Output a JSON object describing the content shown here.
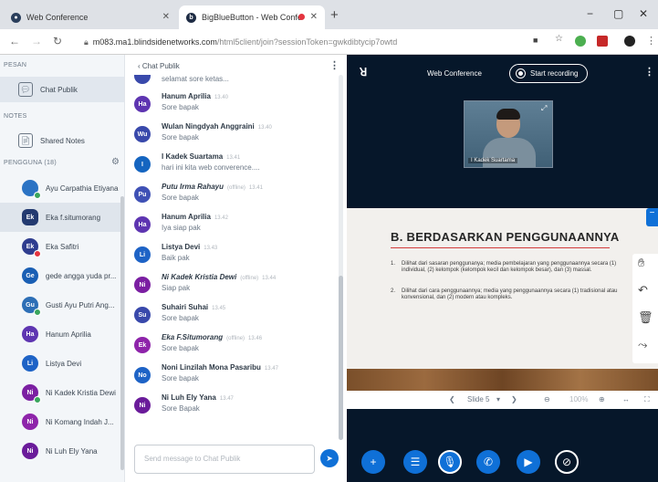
{
  "browser": {
    "tabs": [
      {
        "label": "Web Conference",
        "favicon_color": "#2a3e5c"
      },
      {
        "label": "BigBlueButton - Web Confe",
        "favicon_color": "#1e2c44",
        "recording_dot_color": "#e4343f"
      }
    ],
    "new_tab_icon": "+",
    "win_minimize": "−",
    "win_maximize": "▢",
    "win_close": "✕",
    "url_host": "m083.ma1.blindsidenetworks.com",
    "url_path": "/html5client/join?sessionToken=gwkdibtycip7owtd"
  },
  "sidebar": {
    "messages_header": "PESAN",
    "chat_label": "Chat Publik",
    "notes_header": "NOTES",
    "notes_label": "Shared Notes",
    "users_header": "PENGGUNA (18)",
    "users": [
      {
        "initials": "",
        "name": "Ayu Carpathia Etiyana",
        "color": "#2b73c4",
        "round": true,
        "status_color": "#3aa55d",
        "selected": false
      },
      {
        "initials": "Ek",
        "name": "Eka f.situmorang",
        "color": "#233a70",
        "round": false,
        "status_color": "",
        "selected": true
      },
      {
        "initials": "Ek",
        "name": "Eka Safitri",
        "color": "#2f3d8f",
        "round": true,
        "status_color": "#e4343f",
        "selected": false
      },
      {
        "initials": "Ge",
        "name": "gede angga yuda pr...",
        "color": "#1a5fb4",
        "round": true,
        "status_color": "",
        "selected": false
      },
      {
        "initials": "Gu",
        "name": "Gusti Ayu Putri Ang...",
        "color": "#2d6fb6",
        "round": true,
        "status_color": "#3aa55d",
        "selected": false
      },
      {
        "initials": "Ha",
        "name": "Hanum Aprilia",
        "color": "#5e35b1",
        "round": true,
        "status_color": "",
        "selected": false
      },
      {
        "initials": "Li",
        "name": "Listya Devi",
        "color": "#1e63c6",
        "round": true,
        "status_color": "",
        "selected": false
      },
      {
        "initials": "Ni",
        "name": "Ni Kadek Kristia Dewi",
        "color": "#7b1fa2",
        "round": true,
        "status_color": "#3aa55d",
        "selected": false
      },
      {
        "initials": "Ni",
        "name": "Ni Komang Indah J...",
        "color": "#8e24aa",
        "round": true,
        "status_color": "",
        "selected": false
      },
      {
        "initials": "Ni",
        "name": "Ni Luh Ely Yana",
        "color": "#6a1b9a",
        "round": true,
        "status_color": "",
        "selected": false
      }
    ]
  },
  "chat": {
    "title": "Chat Publik",
    "messages": [
      {
        "initials": "",
        "name": "",
        "time": "",
        "offline": "",
        "text": "selamat sore ketas...",
        "color": "#3949ab",
        "italic": false
      },
      {
        "initials": "Ha",
        "name": "Hanum Aprilia",
        "time": "13.40",
        "offline": "",
        "text": "Sore bapak",
        "color": "#5e35b1",
        "italic": false
      },
      {
        "initials": "Wu",
        "name": "Wulan Ningdyah Anggraini",
        "time": "13.40",
        "offline": "",
        "text": "Sore bapak",
        "color": "#3949ab",
        "italic": false
      },
      {
        "initials": "I",
        "name": "I Kadek Suartama",
        "time": "13.41",
        "offline": "",
        "text": "hari ini kita web converence....",
        "color": "#1565c0",
        "italic": false
      },
      {
        "initials": "Pu",
        "name": "Putu Irma Rahayu",
        "time": "13.41",
        "offline": "(offline)",
        "text": "Sore bapak",
        "color": "#3f51b5",
        "italic": true
      },
      {
        "initials": "Ha",
        "name": "Hanum Aprilia",
        "time": "13.42",
        "offline": "",
        "text": "Iya siap pak",
        "color": "#5e35b1",
        "italic": false
      },
      {
        "initials": "Li",
        "name": "Listya Devi",
        "time": "13.43",
        "offline": "",
        "text": "Baik pak",
        "color": "#1e63c6",
        "italic": false
      },
      {
        "initials": "Ni",
        "name": "Ni Kadek Kristia Dewi",
        "time": "13.44",
        "offline": "(offline)",
        "text": "Siap pak",
        "color": "#7b1fa2",
        "italic": true
      },
      {
        "initials": "Su",
        "name": "Suhairi Suhai",
        "time": "13.45",
        "offline": "",
        "text": "Sore bapak",
        "color": "#3949ab",
        "italic": false
      },
      {
        "initials": "Ek",
        "name": "Eka F.Situmorang",
        "time": "13.46",
        "offline": "(offline)",
        "text": "Sore bapak",
        "color": "#8e24aa",
        "italic": true
      },
      {
        "initials": "No",
        "name": "Noni Linzilah Mona Pasaribu",
        "time": "13.47",
        "offline": "",
        "text": "Sore bapak",
        "color": "#1e63c6",
        "italic": false
      },
      {
        "initials": "Ni",
        "name": "Ni Luh Ely Yana",
        "time": "13.47",
        "offline": "",
        "text": "Sore Bapak",
        "color": "#6a1b9a",
        "italic": false
      }
    ],
    "input_placeholder": "Send message to Chat Publik"
  },
  "main": {
    "title": "Web Conference",
    "record_label": "Start recording",
    "webcam_name": "I Kadek Suartama",
    "slide": {
      "title": "B. BERDASARKAN PENGGUNAANNYA",
      "points": [
        {
          "num": "1.",
          "text": "Dilihat dari sasaran penggunanya; media pembelajaran yang penggunaannya secara (1) individual, (2) kelompok (kelompok kecil dan kelompok besar), dan (3) massal."
        },
        {
          "num": "2.",
          "text": "Dilihat dari cara penggunaannya; media yang penggunaannya secara (1) tradisional atau konvensional, dan (2) modern atau kompleks."
        }
      ]
    },
    "slide_label": "Slide 5",
    "zoom": "100%"
  },
  "colors": {
    "accent": "#0f70d7",
    "dark_bg": "#06172a"
  }
}
